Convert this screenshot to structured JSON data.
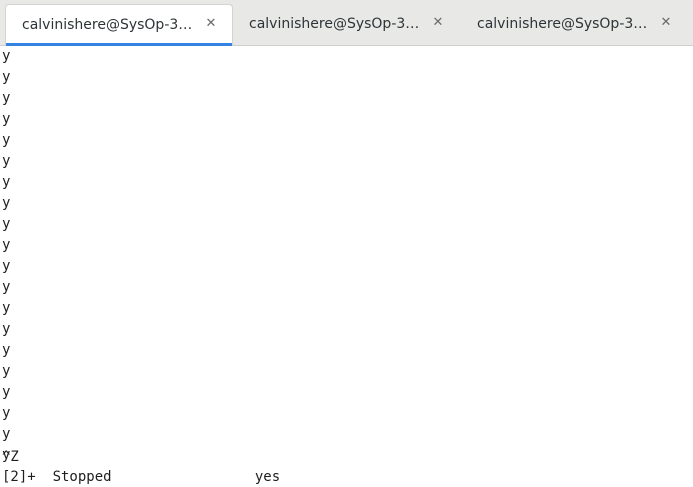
{
  "tabs": [
    {
      "label": "calvinishere@SysOp-3…",
      "close_icon": "close-icon",
      "active": true
    },
    {
      "label": "calvinishere@SysOp-3…",
      "close_icon": "close-icon",
      "active": false
    },
    {
      "label": "calvinishere@SysOp-3…",
      "close_icon": "close-icon",
      "active": false
    }
  ],
  "terminal": {
    "lines": [
      "y",
      "y",
      "y",
      "y",
      "y",
      "y",
      "y",
      "y",
      "y",
      "y",
      "y",
      "y",
      "y",
      "y",
      "y",
      "y",
      "y",
      "y",
      "y",
      "y",
      "^Z",
      "[2]+  Stopped                 yes"
    ]
  },
  "colors": {
    "tab_bar": "#e8e8e7",
    "active_tab_indicator": "#3584e4",
    "terminal_background": "#ffffff",
    "terminal_text": "#1e1e1e"
  }
}
